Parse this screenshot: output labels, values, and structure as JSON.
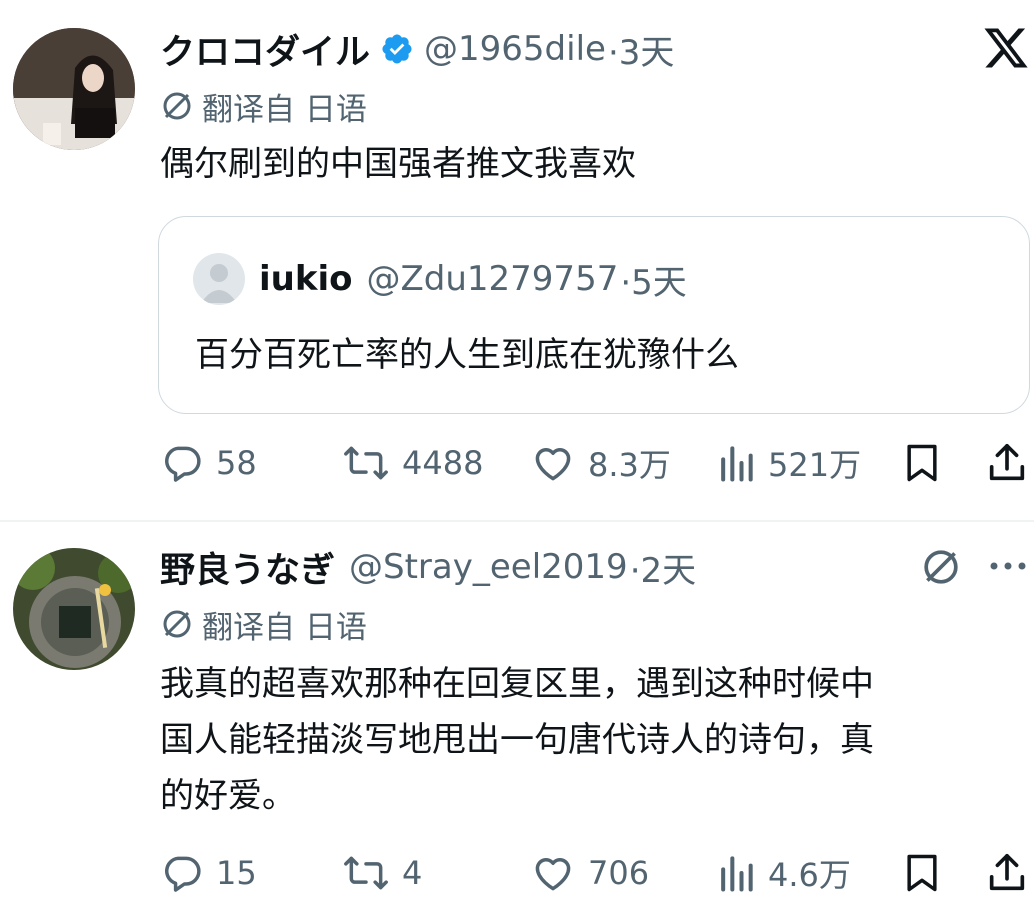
{
  "tweet1": {
    "display_name": "クロコダイル",
    "handle": "@1965dile",
    "time": "·3天",
    "translated_from": "翻译自 日语",
    "text": "偶尔刷到的中国强者推文我喜欢",
    "quote": {
      "display_name": "iukio",
      "handle": "@Zdu1279757",
      "time": "·5天",
      "text": "百分百死亡率的人生到底在犹豫什么"
    },
    "stats": {
      "replies": "58",
      "reposts": "4488",
      "likes": "8.3万",
      "views": "521万"
    }
  },
  "tweet2": {
    "display_name": "野良うなぎ",
    "handle": "@Stray_eel2019",
    "time": "·2天",
    "translated_from": "翻译自 日语",
    "text_lines": [
      "我真的超喜欢那种在回复区里，遇到这种时候中",
      "国人能轻描淡写地甩出一句唐代诗人的诗句，真",
      "的好爱。"
    ],
    "stats": {
      "replies": "15",
      "reposts": "4",
      "likes": "706",
      "views": "4.6万"
    }
  },
  "colors": {
    "text": "#0f1419",
    "secondary": "#536471",
    "verified": "#1d9bf0",
    "border": "#cfd9de"
  },
  "icons": [
    "x-logo-icon",
    "verified-badge-icon",
    "translate-icon",
    "reply-icon",
    "repost-icon",
    "like-icon",
    "views-icon",
    "bookmark-icon",
    "share-icon",
    "more-icon"
  ]
}
